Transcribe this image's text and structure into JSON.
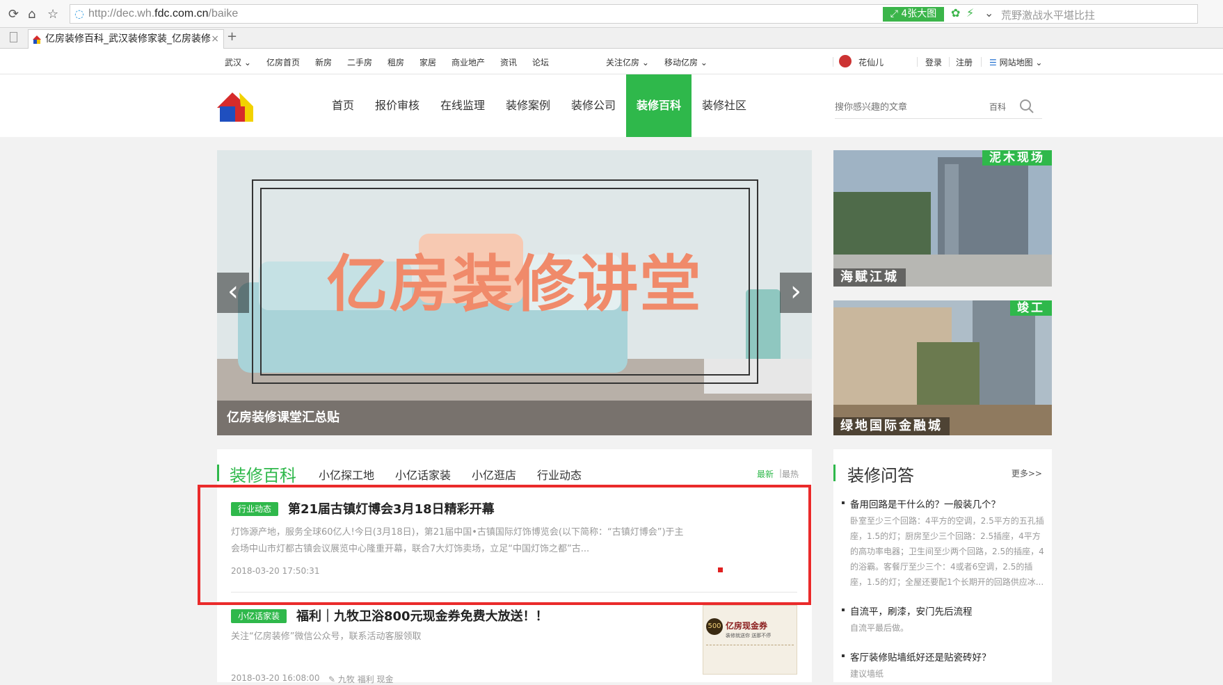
{
  "browser": {
    "url_prefix": "http://dec.wh.",
    "url_domain": "fdc.com.cn",
    "url_path": "/baike",
    "image_count_label": "4张大图",
    "search_suggestion": "荒野激战水平堪比拄",
    "tab_title": "亿房装修百科_武汉装修家装_亿房装修",
    "new_tab": "+",
    "tab_close": "×"
  },
  "topbar": {
    "city": "武汉",
    "links": [
      "亿房首页",
      "新房",
      "二手房",
      "租房",
      "家居",
      "商业地产",
      "资讯",
      "论坛"
    ],
    "follow": "关注亿房",
    "mobile": "移动亿房",
    "user": "花仙儿",
    "login": "登录",
    "register": "注册",
    "sitemap": "网站地图"
  },
  "header": {
    "nav": [
      "首页",
      "报价审核",
      "在线监理",
      "装修案例",
      "装修公司",
      "装修百科",
      "装修社区"
    ],
    "active_index": 5,
    "search_placeholder": "搜你感兴趣的文章",
    "search_category": "百科"
  },
  "banner": {
    "title": "亿房装修讲堂",
    "caption": "亿房装修课堂汇总贴",
    "prev": "‹",
    "next": "›"
  },
  "side_pics": [
    {
      "tag": "泥木现场",
      "name": "海赋江城"
    },
    {
      "tag": "竣工",
      "name": "绿地国际金融城"
    }
  ],
  "baike": {
    "title": "装修百科",
    "tabs": [
      "小亿探工地",
      "小亿话家装",
      "小亿逛店",
      "行业动态"
    ],
    "sort_new": "最新",
    "sort_hot": "最热",
    "articles": [
      {
        "badge": "行业动态",
        "title": "第21届古镇灯博会3月18日精彩开幕",
        "desc": "灯饰源产地，服务全球60亿人!今日(3月18日)，第21届中国•古镇国际灯饰博览会(以下简称：“古镇灯博会”)于主会场中山市灯都古镇会议展览中心隆重开幕，联合7大灯饰卖场，立足“中国灯饰之都”古...",
        "date": "2018-03-20 17:50:31"
      },
      {
        "badge": "小亿话家装",
        "title": "福利｜九牧卫浴800元现金券免费大放送！！",
        "desc": "关注“亿房装修”微信公众号，联系活动客服领取",
        "date": "2018-03-20 16:08:00",
        "tags": "九牧  福利  现金"
      }
    ],
    "coupon_title": "亿房现金券",
    "coupon_sub": "装修就送你 送那不停",
    "coupon_value": "500"
  },
  "qa": {
    "title": "装修问答",
    "more": "更多>>",
    "items": [
      {
        "q": "备用回路是干什么的？一般装几个？",
        "a": "卧室至少三个回路：4平方的空调，2.5平方的五孔插座，1.5的灯；厨房至少三个回路：2.5插座，4平方的高功率电器；卫生间至少两个回路，2.5的插座，4的浴霸。客餐厅至少三个：4或者6空调，2.5的插座，1.5的灯；全屋还要配1个长期开的回路供应冰..."
      },
      {
        "q": "自流平，刷漆，安门先后流程",
        "a": "自流平最后做。"
      },
      {
        "q": "客厅装修贴墙纸好还是贴瓷砖好？",
        "a": "建议墙纸"
      }
    ]
  },
  "colors": {
    "accent": "#2fb84b",
    "highlight": "#ea2b2b"
  }
}
